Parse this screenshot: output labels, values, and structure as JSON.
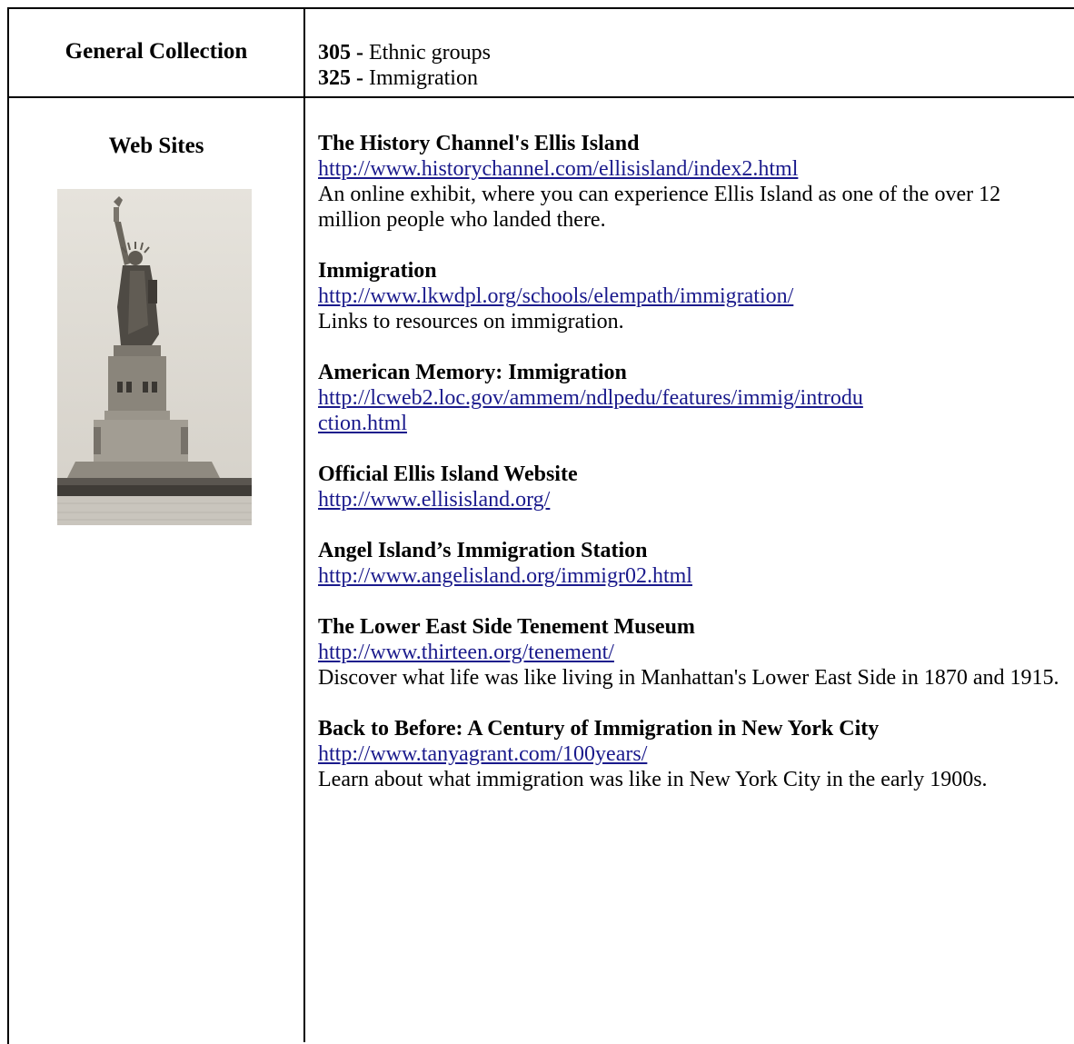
{
  "general_collection": {
    "label": "General Collection",
    "items": [
      {
        "number": "305 -",
        "text": " Ethnic groups"
      },
      {
        "number": "325 -",
        "text": " Immigration"
      }
    ]
  },
  "web_sites": {
    "label": "Web Sites",
    "image": {
      "subject": "Statue of Liberty photograph",
      "icon": "statue-of-liberty-image"
    },
    "entries": [
      {
        "title": "The History Channel's Ellis Island",
        "url": "http://www.historychannel.com/ellisisland/index2.html",
        "description": "An online exhibit, where you can experience Ellis Island as one of the over 12 million people who landed there."
      },
      {
        "title": "Immigration",
        "url": "http://www.lkwdpl.org/schools/elempath/immigration/",
        "description": "Links to resources on immigration."
      },
      {
        "title": "American Memory: Immigration",
        "url": "http://lcweb2.loc.gov/ammem/ndlpedu/features/immig/introduction.html",
        "description": ""
      },
      {
        "title": "Official Ellis Island Website",
        "url": "http://www.ellisisland.org/",
        "description": ""
      },
      {
        "title": "Angel Island’s Immigration Station",
        "url": "http://www.angelisland.org/immigr02.html",
        "description": ""
      },
      {
        "title": "The Lower East Side Tenement Museum",
        "url": "http://www.thirteen.org/tenement/",
        "description": "Discover what life was like living in Manhattan's Lower East Side in 1870 and 1915."
      },
      {
        "title": "Back to Before: A Century of Immigration in New York City",
        "url": "http://www.tanyagrant.com/100years/",
        "description": "Learn about what immigration was like in New York City in the early 1900s."
      }
    ]
  },
  "colors": {
    "link": "#1a1a8c",
    "border": "#000000",
    "text": "#000000"
  }
}
